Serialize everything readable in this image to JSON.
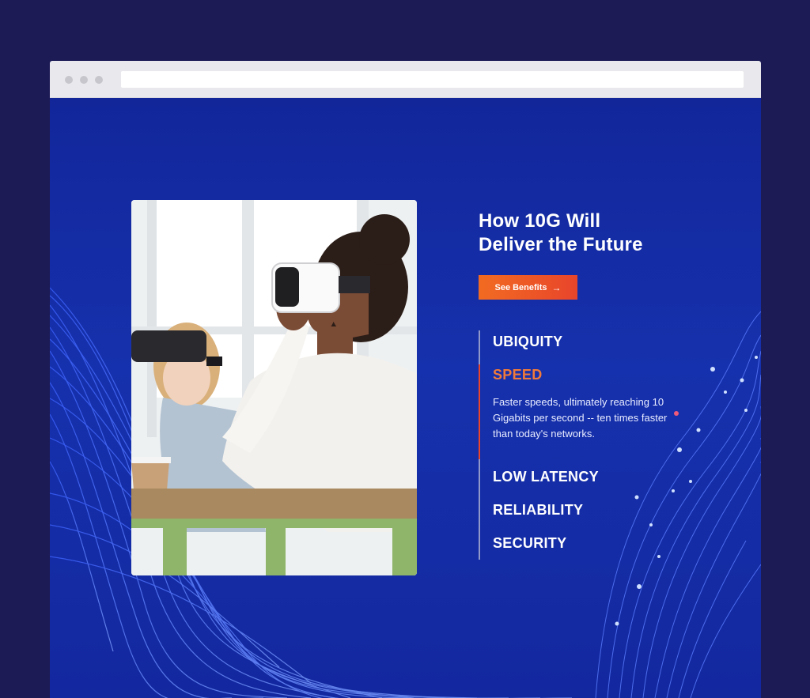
{
  "hero": {
    "title_line1": "How 10G Will",
    "title_line2": "Deliver the Future",
    "cta_label": "See Benefits",
    "cta_arrow": "→"
  },
  "features": {
    "items": [
      {
        "label": "UBIQUITY",
        "active": false
      },
      {
        "label": "SPEED",
        "active": true,
        "description": "Faster speeds, ultimately reaching 10 Gigabits per second -- ten times faster than today's networks."
      },
      {
        "label": "LOW LATENCY",
        "active": false
      },
      {
        "label": "RELIABILITY",
        "active": false
      },
      {
        "label": "SECURITY",
        "active": false
      }
    ]
  },
  "colors": {
    "page_bg": "#1d1b55",
    "content_bg": "#15299b",
    "accent": "#e8452b",
    "active_feature": "#f07a3a"
  }
}
